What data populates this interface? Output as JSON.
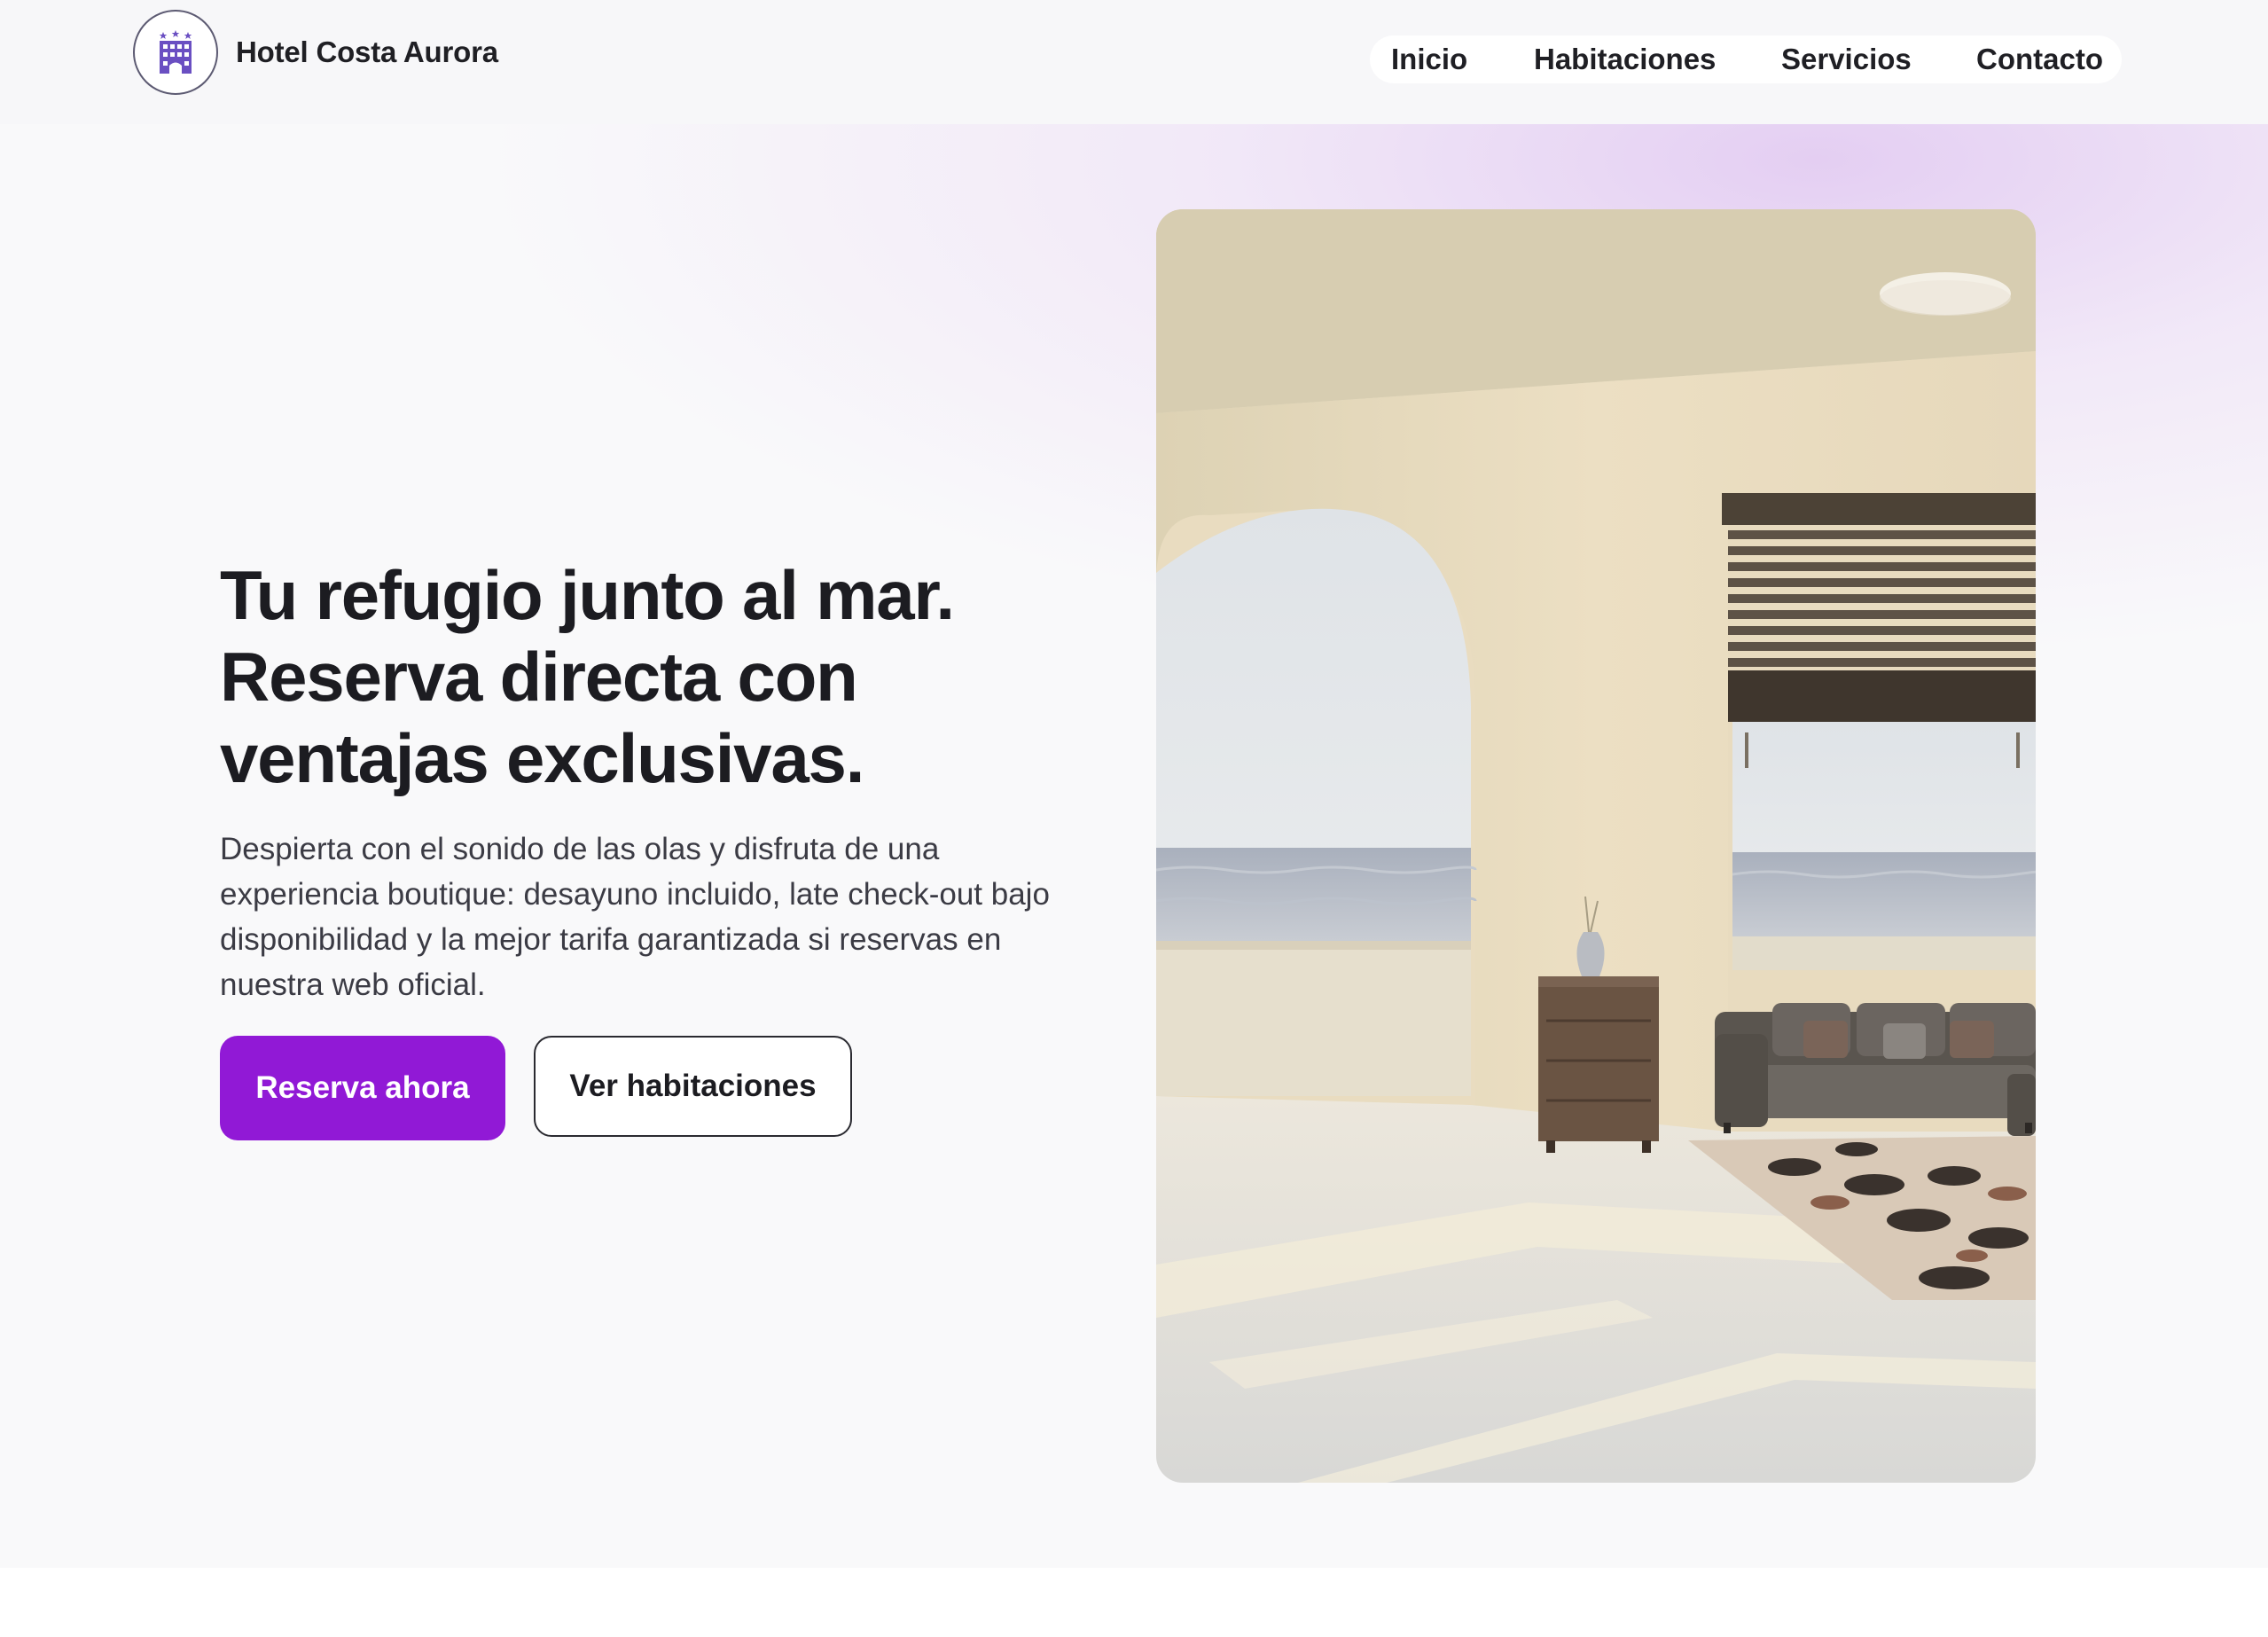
{
  "header": {
    "brand_name": "Hotel Costa Aurora",
    "logo_icon": "hotel-building-icon",
    "nav": [
      "Inicio",
      "Habitaciones",
      "Servicios",
      "Contacto"
    ]
  },
  "hero": {
    "title_lines": [
      "Tu refugio junto al mar.",
      "Reserva directa con",
      "ventajas exclusivas."
    ],
    "text_lines": [
      "Despierta con el sonido de las olas y disfruta de una",
      "experiencia boutique: desayuno incluido, late check-out bajo",
      "disponibilidad y la mejor tarifa garantizada si reservas en",
      "nuestra web oficial."
    ],
    "primary_button": "Reserva ahora",
    "secondary_button": "Ver habitaciones"
  },
  "colors": {
    "accent": "#9119d6",
    "logo": "#6a4fc2"
  }
}
